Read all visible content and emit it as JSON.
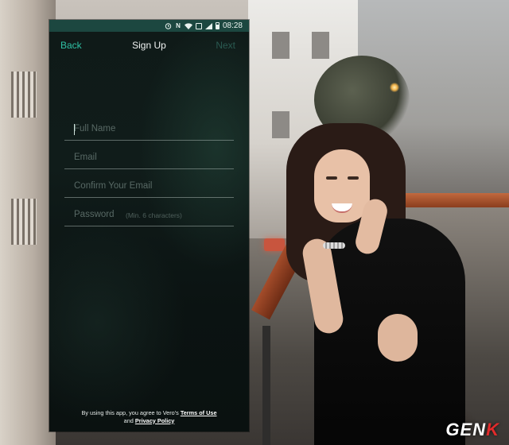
{
  "status_bar": {
    "time": "08:28",
    "icons": [
      "alarm-icon",
      "n-icon",
      "wifi-icon",
      "image-icon",
      "signal-icon",
      "battery-icon"
    ]
  },
  "nav": {
    "back_label": "Back",
    "title": "Sign Up",
    "next_label": "Next"
  },
  "form": {
    "full_name_placeholder": "Full Name",
    "email_placeholder": "Email",
    "confirm_email_placeholder": "Confirm Your Email",
    "password_placeholder": "Password",
    "password_hint": "(Min. 6 characters)"
  },
  "footer": {
    "line1_prefix": "By using this app, you agree to Vero's",
    "terms_link": "Terms of Use",
    "line2_prefix": "and",
    "privacy_link": "Privacy Policy"
  },
  "watermark": {
    "text_main": "GEN",
    "text_accent": "K"
  },
  "colors": {
    "accent": "#2fc0a4",
    "status_bar_bg": "#1c4740",
    "next_disabled": "#2a5a51",
    "screen_bg": "#0f1a18",
    "watermark_accent": "#e22b2b"
  }
}
